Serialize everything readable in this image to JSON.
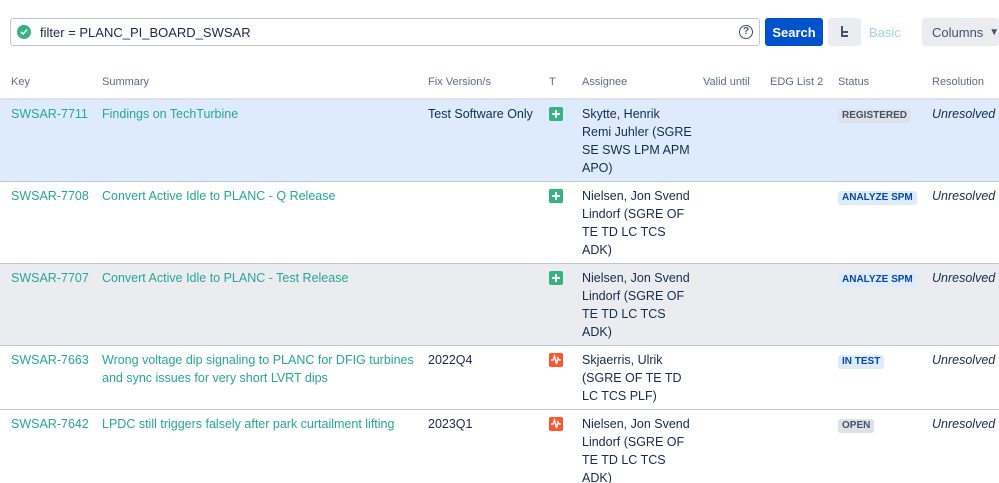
{
  "search": {
    "jql": "filter = PLANC_PI_BOARD_SWSAR",
    "search_label": "Search",
    "basic_label": "Basic",
    "columns_label": "Columns"
  },
  "table": {
    "headers": {
      "key": "Key",
      "summary": "Summary",
      "fix": "Fix Version/s",
      "type": "T",
      "assignee": "Assignee",
      "valid": "Valid until",
      "edg": "EDG List 2",
      "status": "Status",
      "resolution": "Resolution"
    },
    "rows": [
      {
        "key": "SWSAR-7711",
        "summary": "Findings on TechTurbine",
        "fix": "Test Software Only",
        "type_icon": "new-feature-icon",
        "assignee": "Skytte, Henrik Remi Juhler (SGRE SE SWS LPM APM APO)",
        "valid": "",
        "edg": "",
        "status": "REGISTERED",
        "resolution": "Unresolved"
      },
      {
        "key": "SWSAR-7708",
        "summary": "Convert Active Idle to PLANC - Q Release",
        "fix": "",
        "type_icon": "new-feature-icon",
        "assignee": "Nielsen, Jon Svend Lindorf (SGRE OF TE TD LC TCS ADK)",
        "valid": "",
        "edg": "",
        "status": "ANALYZE SPM",
        "resolution": "Unresolved"
      },
      {
        "key": "SWSAR-7707",
        "summary": "Convert Active Idle to PLANC - Test Release",
        "fix": "",
        "type_icon": "new-feature-icon",
        "assignee": "Nielsen, Jon Svend Lindorf (SGRE OF TE TD LC TCS ADK)",
        "valid": "",
        "edg": "",
        "status": "ANALYZE SPM",
        "resolution": "Unresolved"
      },
      {
        "key": "SWSAR-7663",
        "summary": "Wrong voltage dip signaling to PLANC for DFIG turbines and sync issues for very short LVRT dips",
        "fix": "2022Q4",
        "type_icon": "defect-icon",
        "assignee": "Skjaerris, Ulrik (SGRE OF TE TD LC TCS PLF)",
        "valid": "",
        "edg": "",
        "status": "IN TEST",
        "resolution": "Unresolved"
      },
      {
        "key": "SWSAR-7642",
        "summary": "LPDC still triggers falsely after park curtailment lifting",
        "fix": "2023Q1",
        "type_icon": "defect-icon",
        "assignee": "Nielsen, Jon Svend Lindorf (SGRE OF TE TD LC TCS ADK)",
        "valid": "",
        "edg": "",
        "status": "OPEN",
        "resolution": "Unresolved"
      }
    ]
  },
  "colors": {
    "link": "#26a69a",
    "selected_row": "#deebff",
    "alt_row": "#ebecf0",
    "primary_button": "#0052cc"
  }
}
